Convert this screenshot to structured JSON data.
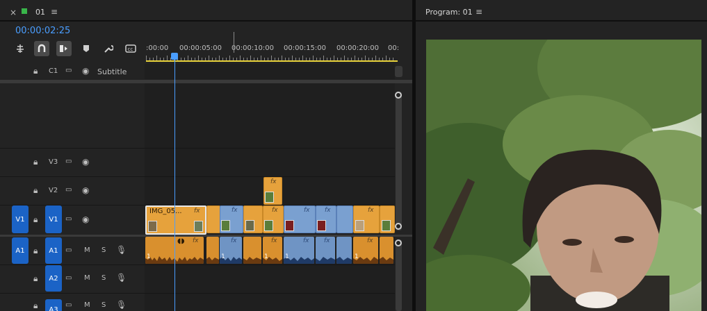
{
  "timeline": {
    "tab": {
      "close_icon": "×",
      "title": "01",
      "menu_icon": "≡"
    },
    "timecode": "00:00:02:25",
    "tools": [
      "ripple-insert-icon",
      "snap-icon",
      "linked-selection-icon",
      "add-marker-icon",
      "wrench-icon",
      "captions-icon"
    ],
    "ruler_labels": [
      ":00:00",
      "00:00:05:00",
      "00:00:10:00",
      "00:00:15:00",
      "00:00:20:00",
      "00:"
    ],
    "subtitle_track": {
      "id": "C1",
      "name": "Subtitle"
    },
    "video_tracks": [
      {
        "id": "V3"
      },
      {
        "id": "V2"
      },
      {
        "id": "V1",
        "source": "V1"
      }
    ],
    "audio_tracks": [
      {
        "id": "A1",
        "source": "A1",
        "m": "M",
        "s": "S"
      },
      {
        "id": "A2",
        "m": "M",
        "s": "S"
      },
      {
        "id": "A3",
        "m": "M",
        "s": "S"
      }
    ],
    "first_clip_name": "IMG_05...",
    "fx_label": "fx",
    "audio_channel_label": "1",
    "colors": {
      "accent_blue": "#4a9eff",
      "clip_orange": "#e6a23c",
      "clip_blue": "#7aa0d0",
      "track_button": "#1b63c6"
    }
  },
  "program": {
    "title": "Program: 01",
    "menu_icon": "≡"
  }
}
